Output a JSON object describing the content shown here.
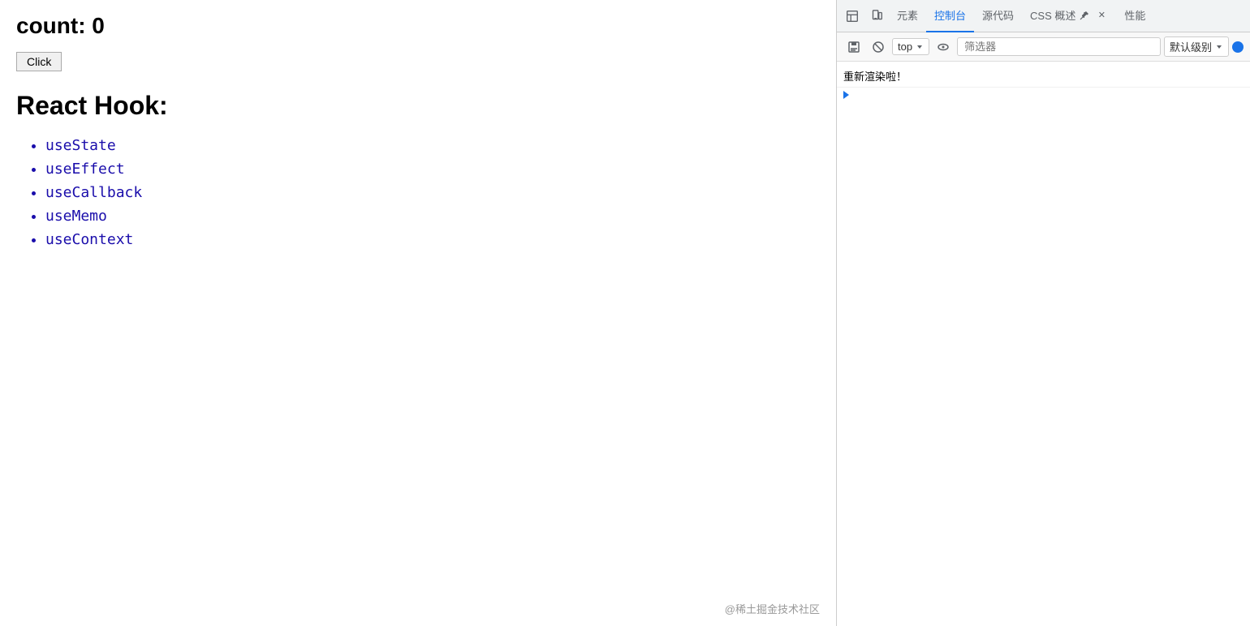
{
  "page": {
    "count_label": "count: 0",
    "click_button_label": "Click",
    "react_hook_title": "React Hook:",
    "hooks_list": [
      "useState",
      "useEffect",
      "useCallback",
      "useMemo",
      "useContext"
    ],
    "footer_text": "@稀土掘金技术社区"
  },
  "devtools": {
    "tabs": [
      {
        "id": "elements",
        "label": "元素",
        "active": false
      },
      {
        "id": "console",
        "label": "控制台",
        "active": true
      },
      {
        "id": "sources",
        "label": "源代码",
        "active": false
      },
      {
        "id": "css-overview",
        "label": "CSS 概述",
        "active": false,
        "has_close": true
      },
      {
        "id": "performance",
        "label": "性能",
        "active": false
      }
    ],
    "toolbar": {
      "top_label": "top",
      "filter_placeholder": "筛选器",
      "default_level_label": "默认级别"
    },
    "console_messages": [
      {
        "text": "重新渲染啦！"
      }
    ],
    "expand_text": ""
  }
}
